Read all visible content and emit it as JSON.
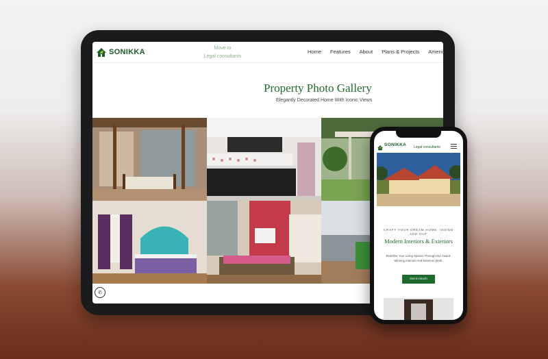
{
  "brand": {
    "name": "SONIKKA",
    "primary_color": "#1e5b2a"
  },
  "tablet": {
    "header": {
      "tagline_line1": "Move to",
      "tagline_line2": "Legal consultants",
      "nav": [
        "Home",
        "Features",
        "About",
        "Plans & Projects",
        "Amenities"
      ]
    },
    "gallery": {
      "title": "Property Photo Gallery",
      "subtitle": "Elegantly Decorated Home With Iconic Views",
      "tiles": [
        "living-room-photo",
        "kitchen-photo",
        "patio-photo",
        "kids-bedroom-photo",
        "daybed-room-photo",
        "balcony-photo"
      ]
    },
    "floating": {
      "icon": "whatsapp-icon"
    }
  },
  "phone": {
    "header": {
      "tagline": "Legal consultants",
      "menu_icon": "hamburger-icon"
    },
    "hero": {
      "image": "villa-exterior-photo"
    },
    "content": {
      "eyebrow": "CRAFT YOUR DREAM HOME, INSIDE AND OUT",
      "heading": "Modern Interiors & Exteriors",
      "body": "Redefine Your Living Spaces Through Our Award-Winning Interiors And Exteriors Work.",
      "cta": "Get in touch"
    }
  }
}
